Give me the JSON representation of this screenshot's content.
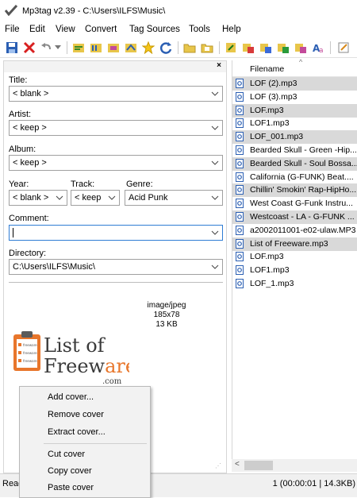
{
  "window": {
    "title": "Mp3tag v2.39  -  C:\\Users\\ILFS\\Music\\"
  },
  "menu": [
    "File",
    "Edit",
    "View",
    "Convert",
    "Tag Sources",
    "Tools",
    "Help"
  ],
  "toolbar_icons": [
    "save-icon",
    "remove-tag-icon",
    "undo-icon",
    "dropdown-arrow-icon",
    "tag-filename-icon",
    "filename-tag-icon",
    "text-filename-icon",
    "filename-text-icon",
    "favorite-star-icon",
    "refresh-icon",
    "open-folder-icon",
    "add-folder-icon",
    "autonumber-icon",
    "tag-source-1-icon",
    "tag-source-2-icon",
    "tag-source-3-icon",
    "tag-source-4-icon",
    "case-conversion-icon",
    "edit-icon"
  ],
  "panel": {
    "close": "×",
    "title_label": "Title:",
    "title_value": "< blank >",
    "artist_label": "Artist:",
    "artist_value": "< keep >",
    "album_label": "Album:",
    "album_value": "< keep >",
    "year_label": "Year:",
    "year_value": "< blank >",
    "track_label": "Track:",
    "track_value": "< keep",
    "genre_label": "Genre:",
    "genre_value": "Acid Punk",
    "comment_label": "Comment:",
    "comment_value": "",
    "directory_label": "Directory:",
    "directory_value": "C:\\Users\\ILFS\\Music\\"
  },
  "cover": {
    "format": "image/jpeg",
    "dimensions": "185x78",
    "size": "13 KB",
    "logo_line1": "List of",
    "logo_line2a": "Freew",
    "logo_line2b": "are",
    "logo_line3": ".com",
    "clip_lines": [
      "freeware",
      "freeware",
      "freeware"
    ]
  },
  "filelist": {
    "column": "Filename",
    "sort_indicator": "^",
    "files": [
      {
        "name": "LOF (2).mp3",
        "selected": true
      },
      {
        "name": "LOF (3).mp3",
        "selected": false
      },
      {
        "name": "LOF.mp3",
        "selected": true
      },
      {
        "name": "LOF1.mp3",
        "selected": false
      },
      {
        "name": "LOF_001.mp3",
        "selected": true
      },
      {
        "name": "Bearded Skull - Green -Hip...",
        "selected": false
      },
      {
        "name": "Bearded Skull - Soul Bossa...",
        "selected": true
      },
      {
        "name": "California (G-FUNK)  Beat....",
        "selected": false
      },
      {
        "name": "Chillin' Smokin' Rap-HipHo...",
        "selected": true
      },
      {
        "name": "West Coast G-Funk Instru...",
        "selected": false
      },
      {
        "name": "Westcoast - LA - G-FUNK ...",
        "selected": true
      },
      {
        "name": "a2002011001-e02-ulaw.MP3",
        "selected": false
      },
      {
        "name": "List of Freeware.mp3",
        "selected": true
      },
      {
        "name": "LOF.mp3",
        "selected": false
      },
      {
        "name": "LOF1.mp3",
        "selected": false
      },
      {
        "name": "LOF_1.mp3",
        "selected": false
      }
    ],
    "scroll_left": "<"
  },
  "status": {
    "ready": "Read",
    "info": "1 (00:00:01 | 14.3KB)"
  },
  "context_menu": {
    "add": "Add cover...",
    "remove": "Remove cover",
    "extract": "Extract cover...",
    "cut": "Cut cover",
    "copy": "Copy cover",
    "paste": "Paste cover"
  },
  "colors": {
    "accent": "#2f7dd4",
    "selection": "#d9d9d9",
    "logo_orange": "#e8762b",
    "logo_dark": "#3a3a3a"
  }
}
